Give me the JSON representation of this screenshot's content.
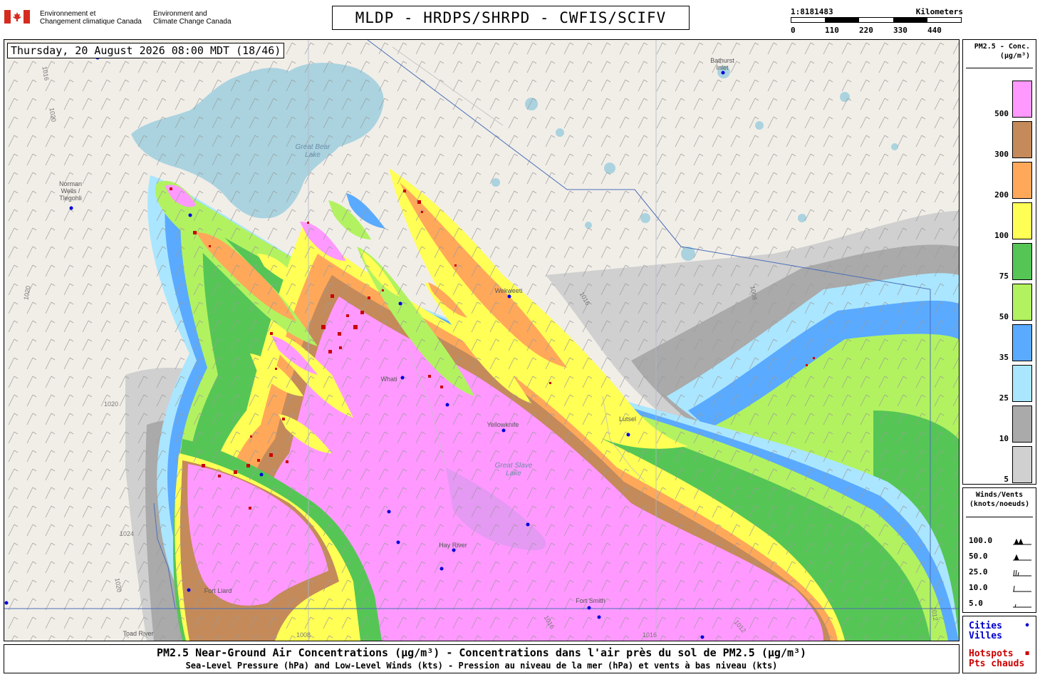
{
  "header": {
    "agency_fr": [
      "Environnement et",
      "Changement climatique Canada"
    ],
    "agency_en": [
      "Environment and",
      "Climate Change Canada"
    ],
    "title": "MLDP - HRDPS/SHRPD - CWFIS/SCIFV",
    "scale": {
      "ratio": "1:8181483",
      "unit": "Kilometers",
      "ticks": [
        "0",
        "110",
        "220",
        "330",
        "440"
      ]
    },
    "flag_icon": "canada-flag-icon"
  },
  "map": {
    "timestamp": "Thursday, 20 August 2026 08:00 MDT (18/46)",
    "places": [
      {
        "name": "Bathurst\nInlet"
      },
      {
        "name": "Norman\nWells /\nTlegohli"
      },
      {
        "name": "Wekweeti"
      },
      {
        "name": "Whati"
      },
      {
        "name": "Yellowknife"
      },
      {
        "name": "Lutsel"
      },
      {
        "name": "Hay River"
      },
      {
        "name": "Fort Smith"
      },
      {
        "name": "Toad River"
      },
      {
        "name": "Fort Liard"
      }
    ],
    "lakes": [
      "Great Bear\nLake",
      "Great Slave\nLake"
    ],
    "isobars": [
      "1016",
      "1020",
      "1020",
      "1024",
      "1020",
      "1020",
      "1016",
      "1012",
      "1008",
      "1016",
      "1012",
      "1008",
      "1016"
    ]
  },
  "legend": {
    "title": [
      "PM2.5 - Conc.",
      "(µg/m³)"
    ],
    "levels": [
      {
        "label": "500",
        "color": "#ff99ff"
      },
      {
        "label": "300",
        "color": "#c48a5a"
      },
      {
        "label": "200",
        "color": "#ffa85a"
      },
      {
        "label": "100",
        "color": "#ffff55"
      },
      {
        "label": "75",
        "color": "#55c655"
      },
      {
        "label": "50",
        "color": "#b2f260"
      },
      {
        "label": "35",
        "color": "#5aaaff"
      },
      {
        "label": "25",
        "color": "#aae6ff"
      },
      {
        "label": "10",
        "color": "#aaaaaa"
      },
      {
        "label": "5",
        "color": "#d0d0d0"
      }
    ]
  },
  "winds": {
    "title": [
      "Winds/Vents",
      "(knots/noeuds)"
    ],
    "rows": [
      "100.0",
      "50.0",
      "25.0",
      "10.0",
      "5.0"
    ]
  },
  "key": {
    "cities": [
      "Cities",
      "Villes"
    ],
    "cities_color": "#0000cc",
    "hotspots": [
      "Hotspots",
      "Pts chauds"
    ],
    "hotspots_color": "#cc0000"
  },
  "footer": {
    "line1": "PM2.5 Near-Ground Air Concentrations (µg/m³) - Concentrations dans l'air près du sol de PM2.5 (µg/m³)",
    "line2": "Sea-Level Pressure (hPa) and Low-Level Winds (kts) - Pression au niveau de la mer (hPa) et vents à bas niveau (kts)"
  }
}
